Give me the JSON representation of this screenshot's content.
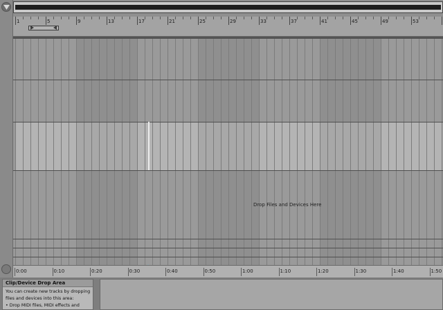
{
  "bar_numbers": [
    "1",
    "5",
    "9",
    "13",
    "17",
    "21",
    "25",
    "29",
    "33",
    "37",
    "41",
    "45",
    "49",
    "53",
    "57"
  ],
  "time_labels": [
    "0:00",
    "0:10",
    "0:20",
    "0:30",
    "0:40",
    "0:50",
    "1:00",
    "1:10",
    "1:20",
    "1:30",
    "1:40",
    "1:50"
  ],
  "drop_area_text": "Drop Files and Devices Here",
  "info_panel": {
    "title": "Clip/Device Drop Area",
    "lines": [
      "You can create new tracks by dropping",
      "files and devices into this area:",
      "• Drop MIDI files, MIDI effects and"
    ]
  },
  "colors": {
    "background": "#8f8f8f",
    "track_gray": "#999999",
    "track_selected": "#b0b0b0",
    "marker_accent": "#6fb8d0"
  },
  "icons": {
    "collapse": "triangle-down-icon",
    "loop_start": "loop-start-icon",
    "loop_end": "loop-end-icon"
  }
}
